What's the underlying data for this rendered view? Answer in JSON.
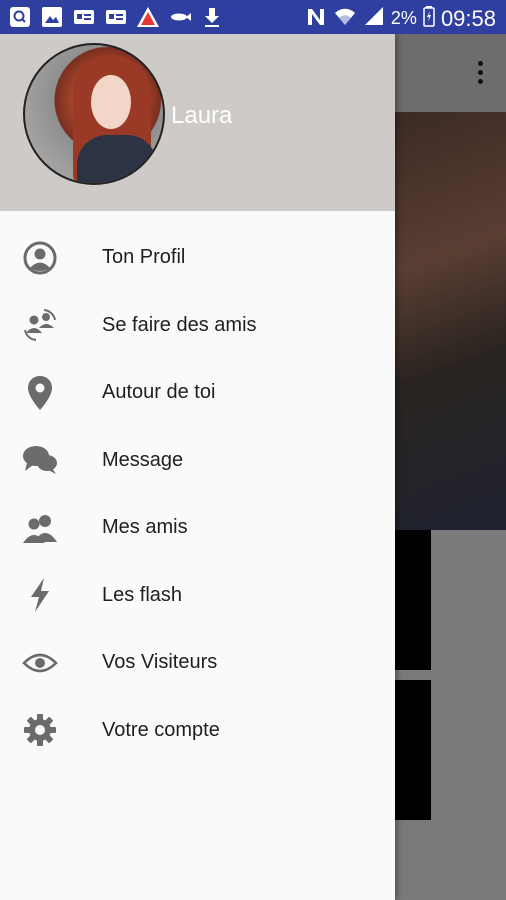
{
  "status_bar": {
    "battery": "2%",
    "time": "09:58",
    "left_icons": [
      "search-notification-icon",
      "image-notification-icon",
      "card-notification-icon",
      "card-notification-icon",
      "warning-icon",
      "fish-icon",
      "download-icon"
    ],
    "right_icons": [
      "nfc-icon",
      "wifi-icon",
      "signal-icon",
      "battery-icon"
    ]
  },
  "drawer": {
    "header": {
      "user_name": "Laura"
    },
    "items": [
      {
        "label": "Ton Profil",
        "icon": "profile-icon"
      },
      {
        "label": "Se faire des amis",
        "icon": "friends-sync-icon"
      },
      {
        "label": "Autour de toi",
        "icon": "location-pin-icon"
      },
      {
        "label": "Message",
        "icon": "chat-bubbles-icon"
      },
      {
        "label": "Mes amis",
        "icon": "people-icon"
      },
      {
        "label": "Les flash",
        "icon": "lightning-icon"
      },
      {
        "label": "Vos Visiteurs",
        "icon": "eye-icon"
      },
      {
        "label": "Votre compte",
        "icon": "gear-icon"
      }
    ]
  },
  "colors": {
    "status_bar": "#2f3f9f",
    "drawer_header": "#cdcac8",
    "drawer_bg": "#fafafa",
    "icon_gray": "#6b6b6b"
  }
}
